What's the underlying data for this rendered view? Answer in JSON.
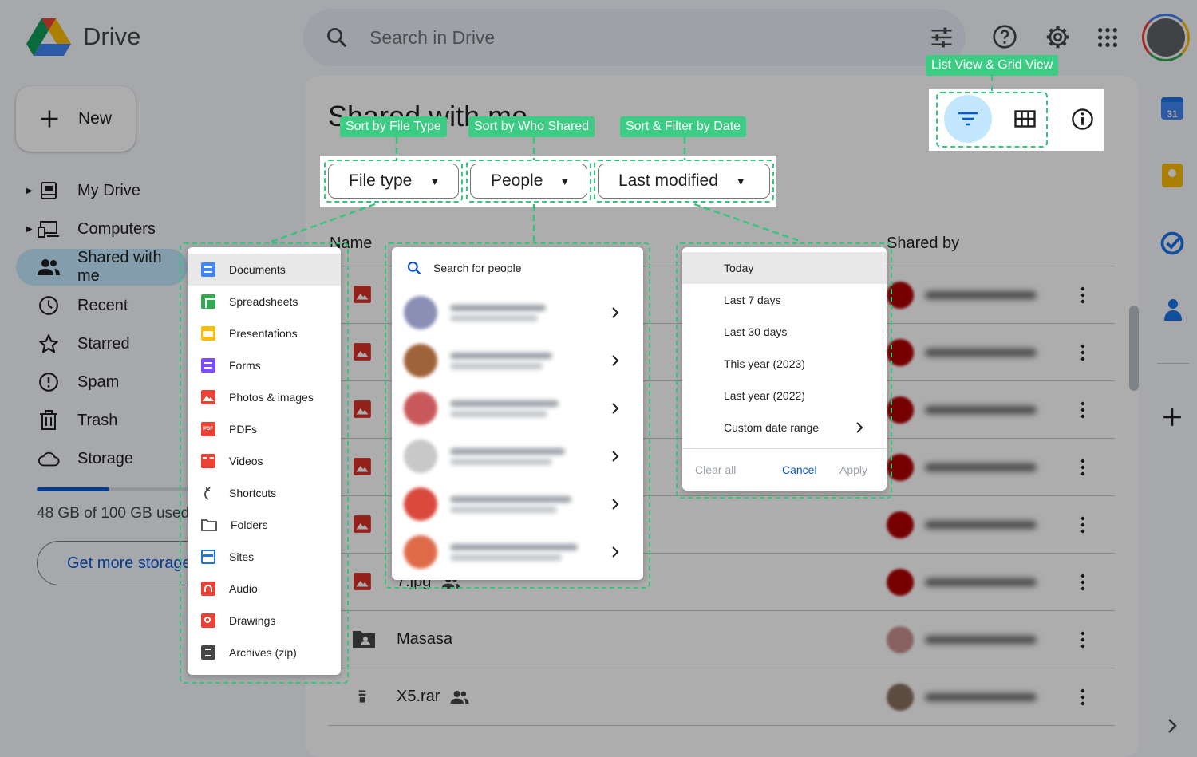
{
  "app": {
    "name": "Drive"
  },
  "search": {
    "placeholder": "Search in Drive"
  },
  "sidebar": {
    "new_label": "New",
    "items": [
      {
        "label": "My Drive",
        "icon": "my-drive-icon"
      },
      {
        "label": "Computers",
        "icon": "computers-icon"
      },
      {
        "label": "Shared with me",
        "icon": "shared-icon"
      },
      {
        "label": "Recent",
        "icon": "recent-icon"
      },
      {
        "label": "Starred",
        "icon": "star-icon"
      },
      {
        "label": "Spam",
        "icon": "spam-icon"
      },
      {
        "label": "Trash",
        "icon": "trash-icon"
      },
      {
        "label": "Storage",
        "icon": "cloud-icon"
      }
    ],
    "storage_text": "48 GB of 100 GB used",
    "storage_fraction": 0.48,
    "get_more_label": "Get more storage"
  },
  "main": {
    "title": "Shared with me",
    "filters": {
      "file_type": "File type",
      "people": "People",
      "last_modified": "Last modified"
    },
    "columns": {
      "name": "Name",
      "shared_by": "Shared by"
    },
    "rows": [
      {
        "name": "",
        "type": "image"
      },
      {
        "name": "",
        "type": "image"
      },
      {
        "name": "",
        "type": "image"
      },
      {
        "name": "",
        "type": "image"
      },
      {
        "name": "",
        "type": "image"
      },
      {
        "name": "7.jpg",
        "type": "image"
      },
      {
        "name": "Masasa",
        "type": "shared-folder"
      },
      {
        "name": "X5.rar",
        "type": "archive"
      }
    ]
  },
  "file_type_menu": {
    "items": [
      {
        "label": "Documents",
        "color": "#4285f4"
      },
      {
        "label": "Spreadsheets",
        "color": "#34a853"
      },
      {
        "label": "Presentations",
        "color": "#fbbc04"
      },
      {
        "label": "Forms",
        "color": "#7c4dff"
      },
      {
        "label": "Photos & images",
        "color": "#ea4335"
      },
      {
        "label": "PDFs",
        "color": "#ea4335"
      },
      {
        "label": "Videos",
        "color": "#ea4335"
      },
      {
        "label": "Shortcuts",
        "color": "#444746"
      },
      {
        "label": "Folders",
        "color": "#444746"
      },
      {
        "label": "Sites",
        "color": "#1a73e8"
      },
      {
        "label": "Audio",
        "color": "#ea4335"
      },
      {
        "label": "Drawings",
        "color": "#ea4335"
      },
      {
        "label": "Archives (zip)",
        "color": "#444746"
      }
    ]
  },
  "people_menu": {
    "placeholder": "Search for people"
  },
  "last_modified_menu": {
    "items": [
      "Today",
      "Last 7 days",
      "Last 30 days",
      "This year (2023)",
      "Last year (2022)",
      "Custom date range"
    ],
    "clear_label": "Clear all",
    "cancel_label": "Cancel",
    "apply_label": "Apply"
  },
  "callouts": {
    "file_type": "Sort by File Type",
    "people": "Sort by Who Shared",
    "date": "Sort & Filter by Date",
    "view": "List View & Grid View"
  },
  "colors": {
    "accent": "#0b57d0",
    "callout": "#3ccc83",
    "selected_nav": "#c2e7ff"
  }
}
